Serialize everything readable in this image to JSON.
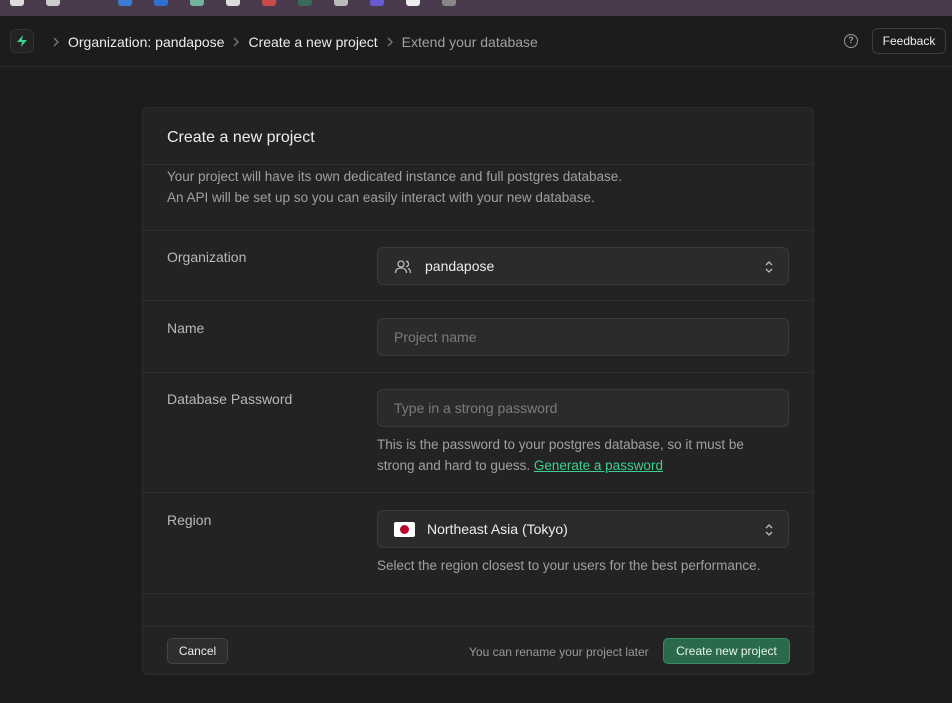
{
  "header": {
    "breadcrumbs": [
      {
        "label": "Organization: pandapose"
      },
      {
        "label": "Create a new project"
      },
      {
        "label": "Extend your database"
      }
    ],
    "feedback_label": "Feedback",
    "help_symbol": "?"
  },
  "form": {
    "title": "Create a new project",
    "description_line1": "Your project will have its own dedicated instance and full postgres database.",
    "description_line2": "An API will be set up so you can easily interact with your new database.",
    "organization": {
      "label": "Organization",
      "value": "pandapose"
    },
    "name": {
      "label": "Name",
      "value": "",
      "placeholder": "Project name"
    },
    "password": {
      "label": "Database Password",
      "value": "",
      "placeholder": "Type in a strong password",
      "help_line1": "This is the password to your postgres database, so it must be",
      "help_line2": "strong and hard to guess.",
      "generate_link": "Generate a password"
    },
    "region": {
      "label": "Region",
      "value": "Northeast Asia (Tokyo)",
      "help": "Select the region closest to your users for the best performance."
    }
  },
  "footer": {
    "cancel_label": "Cancel",
    "rename_note": "You can rename your project later",
    "create_label": "Create new project"
  },
  "colors": {
    "accent": "#3ecf8e",
    "primary_button": "#2a6a4b",
    "background": "#1c1c1c",
    "card": "#232323"
  }
}
